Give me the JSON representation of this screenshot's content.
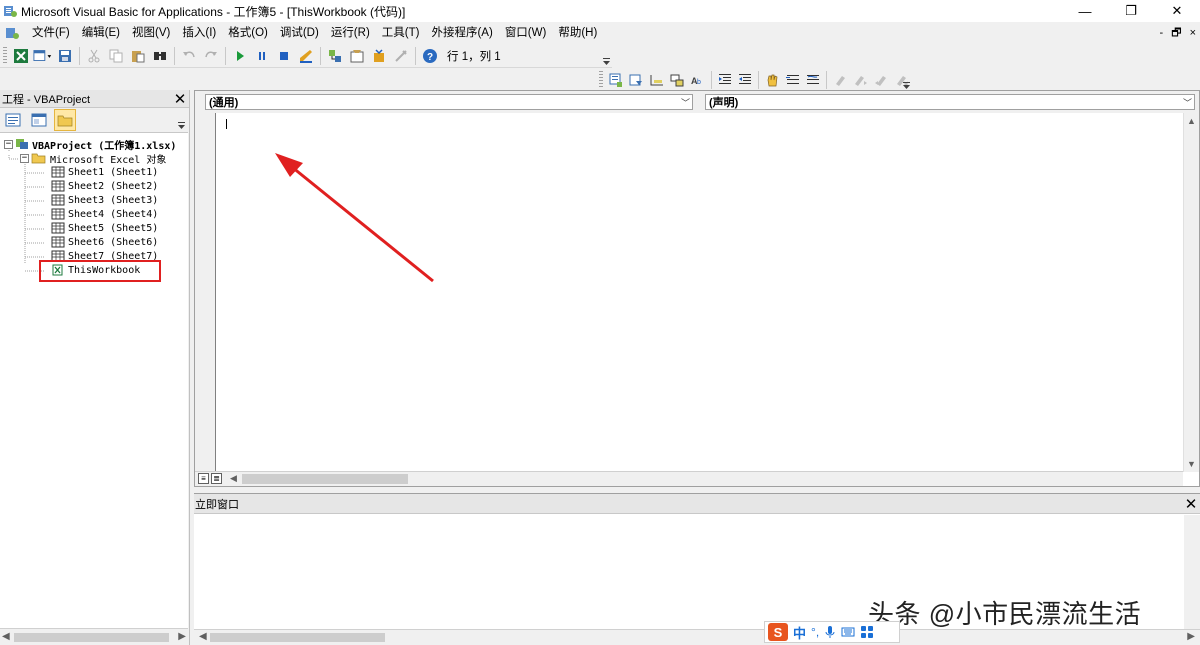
{
  "window": {
    "title": "Microsoft Visual Basic for Applications - 工作簿5 - [ThisWorkbook (代码)]",
    "minimize": "—",
    "restore": "❐",
    "close": "✕"
  },
  "menu": {
    "items": [
      "文件(F)",
      "编辑(E)",
      "视图(V)",
      "插入(I)",
      "格式(O)",
      "调试(D)",
      "运行(R)",
      "工具(T)",
      "外接程序(A)",
      "窗口(W)",
      "帮助(H)"
    ],
    "mdi_minimize": "-",
    "mdi_restore": "🗗",
    "mdi_close": "×"
  },
  "toolbar": {
    "status": "行 1，列 1"
  },
  "project_explorer": {
    "title": "工程 - VBAProject",
    "close": "✕",
    "tree": [
      {
        "label": "VBAProject (工作簿1.xlsx)",
        "expander": "−"
      },
      {
        "label": "Microsoft Excel 对象",
        "expander": "−"
      },
      {
        "label": "Sheet1 (Sheet1)"
      },
      {
        "label": "Sheet2 (Sheet2)"
      },
      {
        "label": "Sheet3 (Sheet3)"
      },
      {
        "label": "Sheet4 (Sheet4)"
      },
      {
        "label": "Sheet5 (Sheet5)"
      },
      {
        "label": "Sheet6 (Sheet6)"
      },
      {
        "label": "Sheet7 (Sheet7)"
      },
      {
        "label": "ThisWorkbook"
      }
    ]
  },
  "code_window": {
    "object_dropdown": "(通用)",
    "procedure_dropdown": "(声明)"
  },
  "immediate_window": {
    "title": "立即窗口",
    "close": "✕"
  },
  "ime": {
    "logo": "S",
    "mode": "中",
    "punct": "°,"
  },
  "watermark": "头条 @小市民漂流生活",
  "colors": {
    "highlight": "#e02020",
    "arrow": "#e02020"
  }
}
